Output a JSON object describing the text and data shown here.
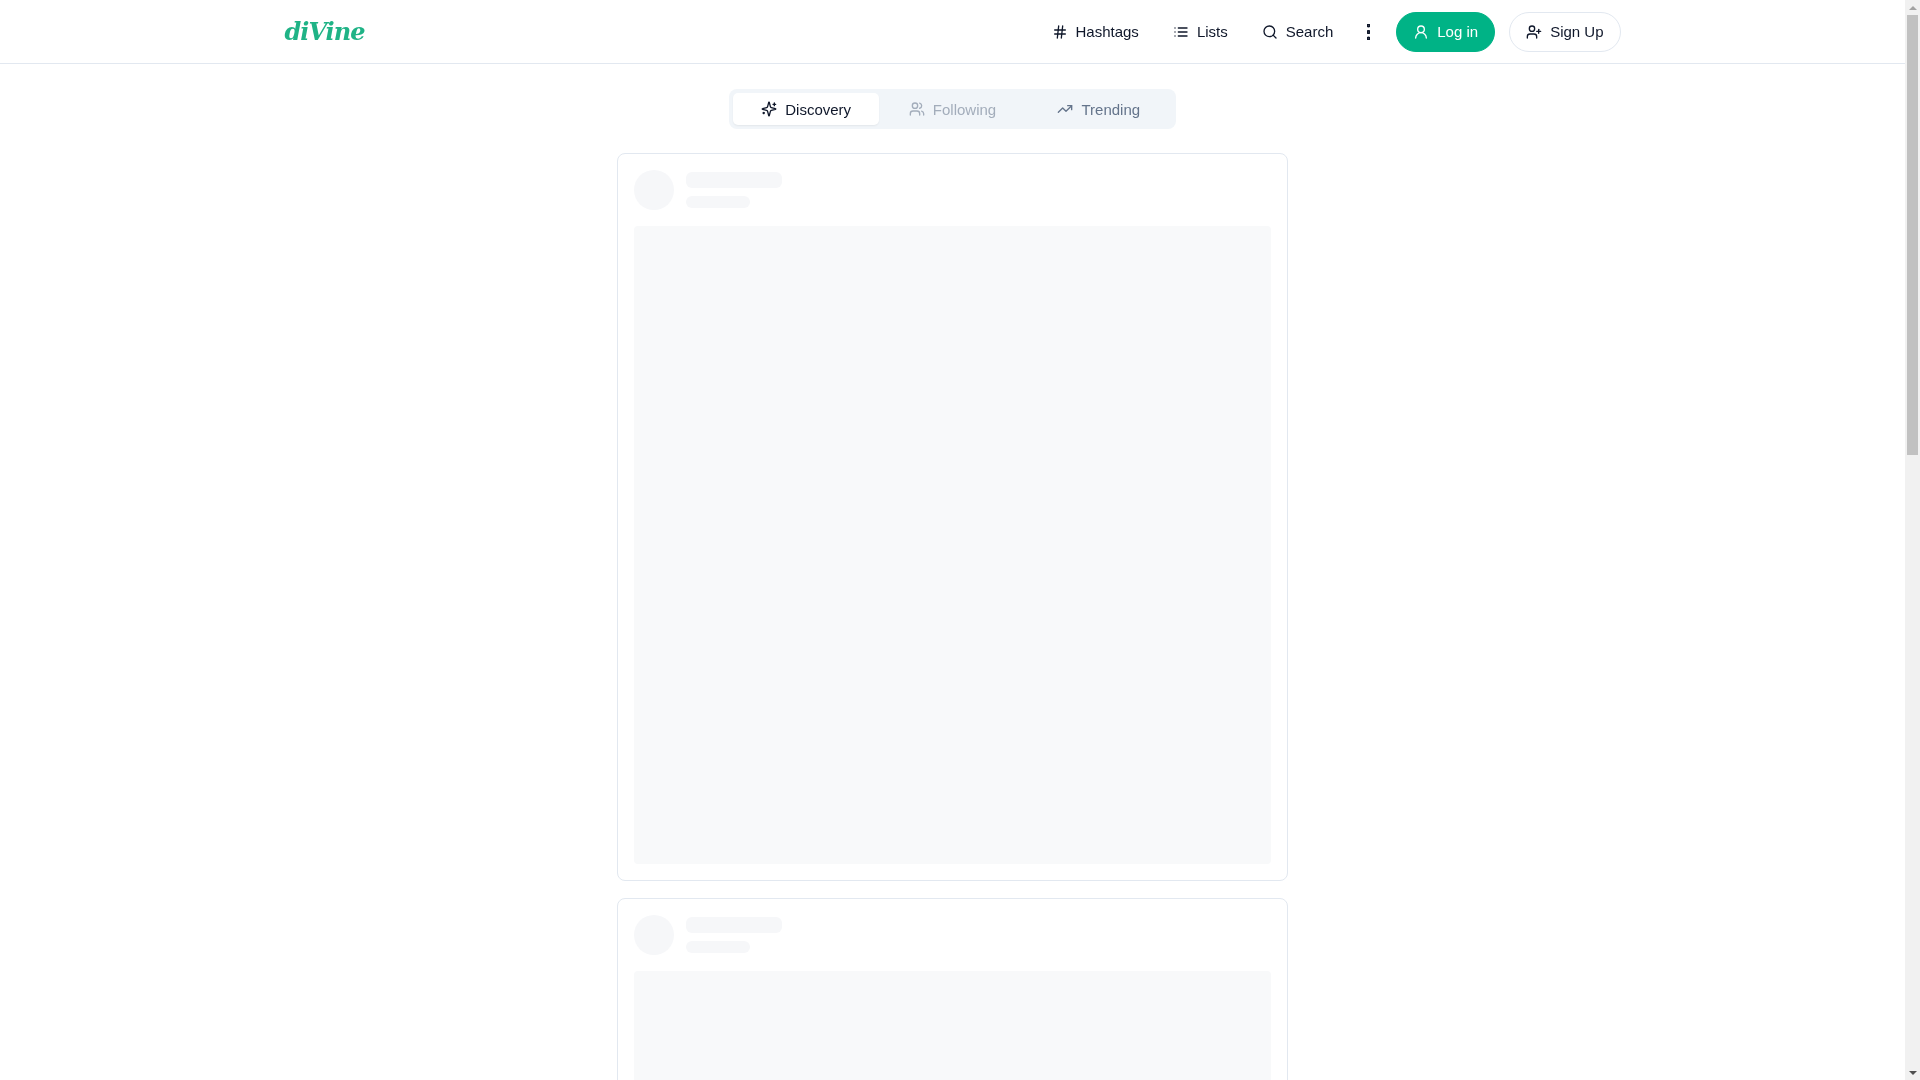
{
  "header": {
    "logo": "diVine",
    "nav": [
      {
        "kind": "hashtag",
        "label": "Hashtags"
      },
      {
        "kind": "list",
        "label": "Lists"
      },
      {
        "kind": "search",
        "label": "Search"
      },
      {
        "kind": "more"
      }
    ],
    "buttons": [
      {
        "kind": "primary",
        "label": "Log in"
      },
      {
        "kind": "outline",
        "label": "Sign Up"
      }
    ]
  },
  "tabs": [
    {
      "label": "Discovery",
      "selected": true,
      "disabled": false
    },
    {
      "label": "Following",
      "selected": false,
      "disabled": true
    },
    {
      "label": "Trending",
      "selected": false,
      "disabled": false
    }
  ],
  "feed": [
    {
      "kind": "loading"
    },
    {
      "kind": "loading"
    }
  ]
}
